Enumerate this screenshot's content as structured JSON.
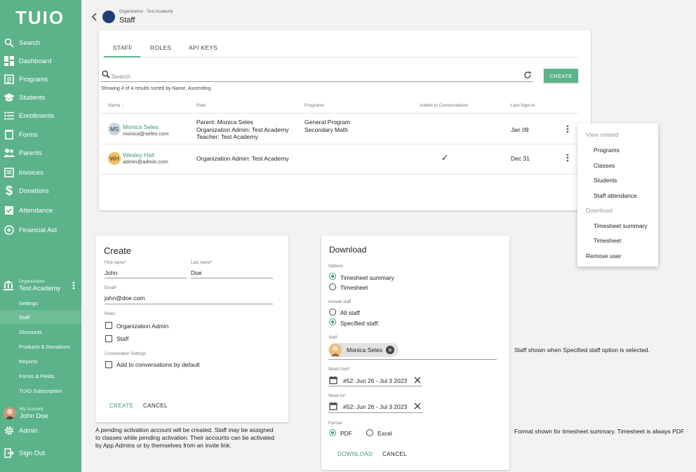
{
  "sidebar": {
    "logo": "TUIO",
    "items": [
      {
        "label": "Search",
        "icon": "search-icon"
      },
      {
        "label": "Dashboard",
        "icon": "dashboard-icon"
      },
      {
        "label": "Programs",
        "icon": "programs-icon"
      },
      {
        "label": "Students",
        "icon": "students-icon"
      },
      {
        "label": "Enrollments",
        "icon": "enrollments-icon"
      },
      {
        "label": "Forms",
        "icon": "forms-icon"
      },
      {
        "label": "Parents",
        "icon": "parents-icon"
      },
      {
        "label": "Invoices",
        "icon": "invoices-icon"
      },
      {
        "label": "Donations",
        "icon": "dollar-icon"
      },
      {
        "label": "Attendance",
        "icon": "attendance-icon"
      },
      {
        "label": "Financial Aid",
        "icon": "plus-circle-icon"
      }
    ],
    "org_small": "Organization",
    "org_name": "Test Academy",
    "sub_items": [
      "Settings",
      "Staff",
      "Discounts",
      "Products & Donations",
      "Reports",
      "Forms & Fields",
      "TUIO Subscription"
    ],
    "account_small": "My Account",
    "account_name": "John Doe",
    "admin": "Admin",
    "signout": "Sign Out",
    "colors": {
      "sidebar": "#5cb389",
      "accent": "#3a9d6d"
    }
  },
  "header": {
    "crumb": "Organization · Test Academy",
    "title": "Staff"
  },
  "staff": {
    "tabs": [
      "STAFF",
      "ROLES",
      "API KEYS"
    ],
    "search_placeholder": "Search",
    "create": "CREATE",
    "showing": "Showing 4 of 4 results sorted by Name, Ascending",
    "columns": [
      "Name",
      "Role",
      "Programs",
      "Added to Conversations",
      "Last Sign-in"
    ],
    "rows": [
      {
        "initials": "MS",
        "name": "Monica Seles",
        "email": "monica@seles.com",
        "roles": [
          "Parent: Monica Seles",
          "Organization Admin: Test Academy",
          "Teacher: Test Academy"
        ],
        "programs": [
          "General Program",
          "Secondary Math"
        ],
        "conversations": "",
        "last_signin": "Jan 09"
      },
      {
        "initials": "WH",
        "name": "Wesley Hall",
        "email": "admin@admin.com",
        "roles": [
          "Organization Admin: Test Academy"
        ],
        "programs": [],
        "conversations": "✓",
        "last_signin": "Dec 31"
      }
    ]
  },
  "menu": {
    "view_related": "View related",
    "programs": "Programs",
    "classes": "Classes",
    "students": "Students",
    "staff_attendance": "Staff attendance",
    "download": "Download",
    "timesheet_summary": "Timesheet summary",
    "timesheet": "Timesheet",
    "remove_user": "Remove user"
  },
  "create": {
    "title": "Create",
    "first_name_label": "First name*",
    "first_name": "John",
    "last_name_label": "Last name*",
    "last_name": "Doe",
    "email_label": "Email*",
    "email": "john@doe.com",
    "roles_label": "Roles",
    "role_org_admin": "Organization Admin",
    "role_staff": "Staff",
    "conv_label": "Conversation Settings",
    "conv_option": "Add to conversations by default",
    "create_btn": "CREATE",
    "cancel_btn": "CANCEL",
    "note": [
      "A pending activation account will be created. Staff may be assigned",
      "to classes while pending activation. Their accounts can be activated",
      "by App Admins or by themselves from an invite link."
    ]
  },
  "download": {
    "title": "Download",
    "options_label": "Options",
    "opt_summary": "Timesheet summary",
    "opt_timesheet": "Timesheet",
    "include_label": "Include staff",
    "all_staff": "All staff",
    "specified_staff": "Specified staff:",
    "staff_label": "Staff",
    "chip_name": "Monica Seles",
    "week_from_label": "Week from*",
    "week_from": "#52: Jun 26 - Jul 3 2023",
    "week_to_label": "Week to*",
    "week_to": "#52: Jun 26 - Jul 3 2023",
    "format_label": "Format",
    "pdf": "PDF",
    "excel": "Excel",
    "download_btn": "DOWNLOAD",
    "cancel_btn": "CANCEL",
    "note_staff": "Staff shown when Specified staff option is selected.",
    "note_format": "Format shown for timesheet summary. Timesheet is always PDF"
  }
}
